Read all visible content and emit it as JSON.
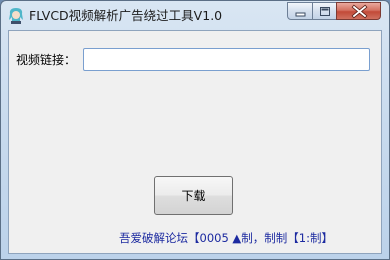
{
  "window": {
    "title": "FLVCD视频解析广告绕过工具V1.0",
    "icon": "character-app-icon",
    "controls": {
      "minimize": "minimize-icon",
      "maximize": "maximize-icon",
      "close": "close-icon"
    }
  },
  "form": {
    "label": "视频链接：",
    "input_value": "",
    "input_placeholder": "",
    "download_label": "下载"
  },
  "footer": {
    "credit": "吾爱破解论坛【0005 ▲制，制制【1:制】"
  },
  "colors": {
    "credit_text": "#1c2aa0",
    "close_button": "#c9503e",
    "input_border": "#7a9fcf"
  }
}
